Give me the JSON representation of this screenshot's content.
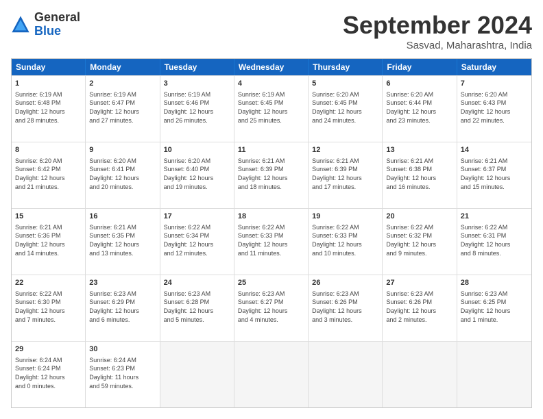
{
  "logo": {
    "general": "General",
    "blue": "Blue"
  },
  "header": {
    "month": "September 2024",
    "location": "Sasvad, Maharashtra, India"
  },
  "days": [
    "Sunday",
    "Monday",
    "Tuesday",
    "Wednesday",
    "Thursday",
    "Friday",
    "Saturday"
  ],
  "rows": [
    [
      {
        "day": "",
        "info": ""
      },
      {
        "day": "2",
        "info": "Sunrise: 6:19 AM\nSunset: 6:47 PM\nDaylight: 12 hours\nand 27 minutes."
      },
      {
        "day": "3",
        "info": "Sunrise: 6:19 AM\nSunset: 6:46 PM\nDaylight: 12 hours\nand 26 minutes."
      },
      {
        "day": "4",
        "info": "Sunrise: 6:19 AM\nSunset: 6:45 PM\nDaylight: 12 hours\nand 25 minutes."
      },
      {
        "day": "5",
        "info": "Sunrise: 6:20 AM\nSunset: 6:45 PM\nDaylight: 12 hours\nand 24 minutes."
      },
      {
        "day": "6",
        "info": "Sunrise: 6:20 AM\nSunset: 6:44 PM\nDaylight: 12 hours\nand 23 minutes."
      },
      {
        "day": "7",
        "info": "Sunrise: 6:20 AM\nSunset: 6:43 PM\nDaylight: 12 hours\nand 22 minutes."
      }
    ],
    [
      {
        "day": "8",
        "info": "Sunrise: 6:20 AM\nSunset: 6:42 PM\nDaylight: 12 hours\nand 21 minutes."
      },
      {
        "day": "9",
        "info": "Sunrise: 6:20 AM\nSunset: 6:41 PM\nDaylight: 12 hours\nand 20 minutes."
      },
      {
        "day": "10",
        "info": "Sunrise: 6:20 AM\nSunset: 6:40 PM\nDaylight: 12 hours\nand 19 minutes."
      },
      {
        "day": "11",
        "info": "Sunrise: 6:21 AM\nSunset: 6:39 PM\nDaylight: 12 hours\nand 18 minutes."
      },
      {
        "day": "12",
        "info": "Sunrise: 6:21 AM\nSunset: 6:39 PM\nDaylight: 12 hours\nand 17 minutes."
      },
      {
        "day": "13",
        "info": "Sunrise: 6:21 AM\nSunset: 6:38 PM\nDaylight: 12 hours\nand 16 minutes."
      },
      {
        "day": "14",
        "info": "Sunrise: 6:21 AM\nSunset: 6:37 PM\nDaylight: 12 hours\nand 15 minutes."
      }
    ],
    [
      {
        "day": "15",
        "info": "Sunrise: 6:21 AM\nSunset: 6:36 PM\nDaylight: 12 hours\nand 14 minutes."
      },
      {
        "day": "16",
        "info": "Sunrise: 6:21 AM\nSunset: 6:35 PM\nDaylight: 12 hours\nand 13 minutes."
      },
      {
        "day": "17",
        "info": "Sunrise: 6:22 AM\nSunset: 6:34 PM\nDaylight: 12 hours\nand 12 minutes."
      },
      {
        "day": "18",
        "info": "Sunrise: 6:22 AM\nSunset: 6:33 PM\nDaylight: 12 hours\nand 11 minutes."
      },
      {
        "day": "19",
        "info": "Sunrise: 6:22 AM\nSunset: 6:33 PM\nDaylight: 12 hours\nand 10 minutes."
      },
      {
        "day": "20",
        "info": "Sunrise: 6:22 AM\nSunset: 6:32 PM\nDaylight: 12 hours\nand 9 minutes."
      },
      {
        "day": "21",
        "info": "Sunrise: 6:22 AM\nSunset: 6:31 PM\nDaylight: 12 hours\nand 8 minutes."
      }
    ],
    [
      {
        "day": "22",
        "info": "Sunrise: 6:22 AM\nSunset: 6:30 PM\nDaylight: 12 hours\nand 7 minutes."
      },
      {
        "day": "23",
        "info": "Sunrise: 6:23 AM\nSunset: 6:29 PM\nDaylight: 12 hours\nand 6 minutes."
      },
      {
        "day": "24",
        "info": "Sunrise: 6:23 AM\nSunset: 6:28 PM\nDaylight: 12 hours\nand 5 minutes."
      },
      {
        "day": "25",
        "info": "Sunrise: 6:23 AM\nSunset: 6:27 PM\nDaylight: 12 hours\nand 4 minutes."
      },
      {
        "day": "26",
        "info": "Sunrise: 6:23 AM\nSunset: 6:26 PM\nDaylight: 12 hours\nand 3 minutes."
      },
      {
        "day": "27",
        "info": "Sunrise: 6:23 AM\nSunset: 6:26 PM\nDaylight: 12 hours\nand 2 minutes."
      },
      {
        "day": "28",
        "info": "Sunrise: 6:23 AM\nSunset: 6:25 PM\nDaylight: 12 hours\nand 1 minute."
      }
    ],
    [
      {
        "day": "29",
        "info": "Sunrise: 6:24 AM\nSunset: 6:24 PM\nDaylight: 12 hours\nand 0 minutes."
      },
      {
        "day": "30",
        "info": "Sunrise: 6:24 AM\nSunset: 6:23 PM\nDaylight: 11 hours\nand 59 minutes."
      },
      {
        "day": "",
        "info": ""
      },
      {
        "day": "",
        "info": ""
      },
      {
        "day": "",
        "info": ""
      },
      {
        "day": "",
        "info": ""
      },
      {
        "day": "",
        "info": ""
      }
    ]
  ],
  "row0_day1": {
    "day": "1",
    "info": "Sunrise: 6:19 AM\nSunset: 6:48 PM\nDaylight: 12 hours\nand 28 minutes."
  }
}
